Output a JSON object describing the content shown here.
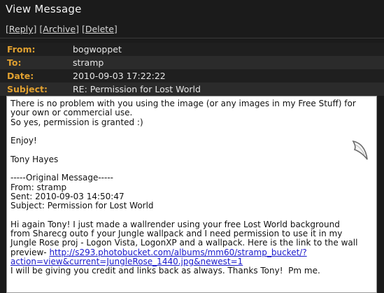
{
  "window": {
    "title": "View Message"
  },
  "actions": {
    "reply": "Reply",
    "archive": "Archive",
    "delete": "Delete"
  },
  "header": {
    "from_label": "From:",
    "from": "bogwoppet",
    "to_label": "To:",
    "to": "stramp",
    "date_label": "Date:",
    "date": "2010-09-03 17:22:22",
    "subject_label": "Subject:",
    "subject": "RE: Permission for Lost World"
  },
  "body": {
    "p1": "There is no problem with you using the image (or any images in my Free Stuff) for\nyour own or commercial use.\nSo yes, permission is granted :)",
    "p2": "Enjoy!",
    "p3": "Tony Hayes",
    "original_header": "-----Original Message-----",
    "orig_from": "From: stramp",
    "orig_sent": "Sent: 2010-09-03 14:50:47",
    "orig_subject": "Subject: Permission for Lost World",
    "p4": "Hi again Tony! I just made a wallrender using your free Lost World background\nfrom Sharecg outo f your Jungle wallpack and I need permission to use it in my\nJungle Rose proj - Logon Vista, LogonXP and a wallpack. Here is the link to the wall\npreview- ",
    "link": "http://s293.photobucket.com/albums/mm60/stramp_bucket/?\naction=view&current=JungleRose_1440.jpg&newest=1",
    "p5": "I will be giving you credit and links back as always. Thanks Tony!  Pm me."
  },
  "colors": {
    "label": "#e0a030",
    "background": "#1b1b1b",
    "link": "#1a1acc"
  },
  "icons": {
    "quote": "quote-mark-icon"
  }
}
